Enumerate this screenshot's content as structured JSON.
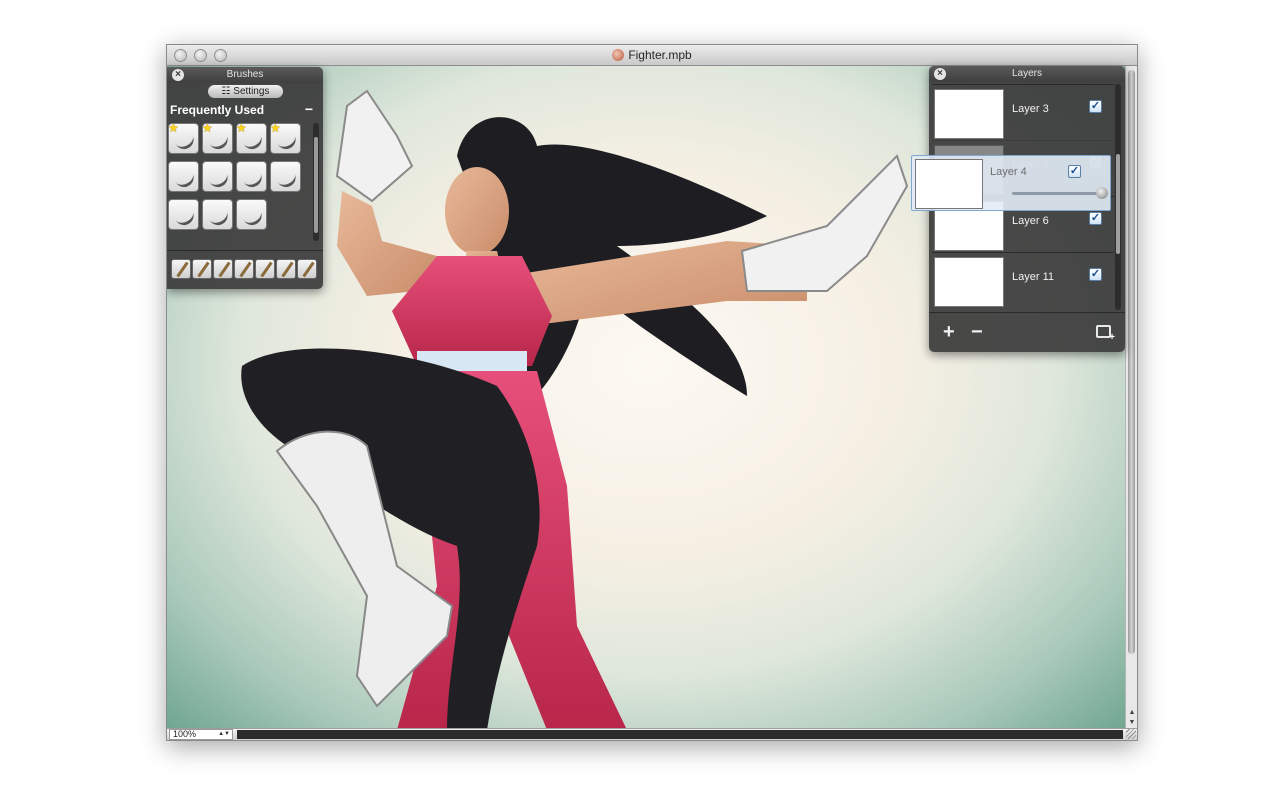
{
  "window": {
    "title": "Fighter.mpb"
  },
  "canvas": {
    "zoom": "100%"
  },
  "brushes_panel": {
    "title": "Brushes",
    "settings_label": "Settings",
    "section_label": "Frequently Used",
    "brush_rows": [
      [
        {
          "name": "ink-brush",
          "favorite": true
        },
        {
          "name": "pencil-brush",
          "favorite": true
        },
        {
          "name": "ring-brush",
          "favorite": true
        },
        {
          "name": "airbrush-red",
          "favorite": true
        }
      ],
      [
        {
          "name": "spatter-brush",
          "favorite": false
        },
        {
          "name": "smudge-brush",
          "favorite": false
        },
        {
          "name": "texture-brush",
          "favorite": false
        },
        {
          "name": "soft-blue-brush",
          "favorite": false
        }
      ],
      [
        {
          "name": "black-ink-brush",
          "favorite": false
        },
        {
          "name": "fine-pen-brush",
          "favorite": false
        },
        {
          "name": "marker-brush",
          "favorite": false
        }
      ]
    ],
    "tools": [
      "pen-tool",
      "pencil-tool",
      "dropper-tool",
      "brush-tool",
      "star-tool",
      "spray-tool",
      "blender-tool"
    ]
  },
  "layers_panel": {
    "title": "Layers",
    "layers": [
      {
        "name": "Layer 3",
        "visible": true,
        "dragging": false
      },
      {
        "name": "Layer 4",
        "visible": true,
        "dragging": true
      },
      {
        "name": "Layer 6",
        "visible": true,
        "dragging": false
      },
      {
        "name": "Layer 11",
        "visible": true,
        "dragging": false
      }
    ],
    "drag_label": "Layer 4",
    "add_label": "+",
    "remove_label": "−"
  }
}
